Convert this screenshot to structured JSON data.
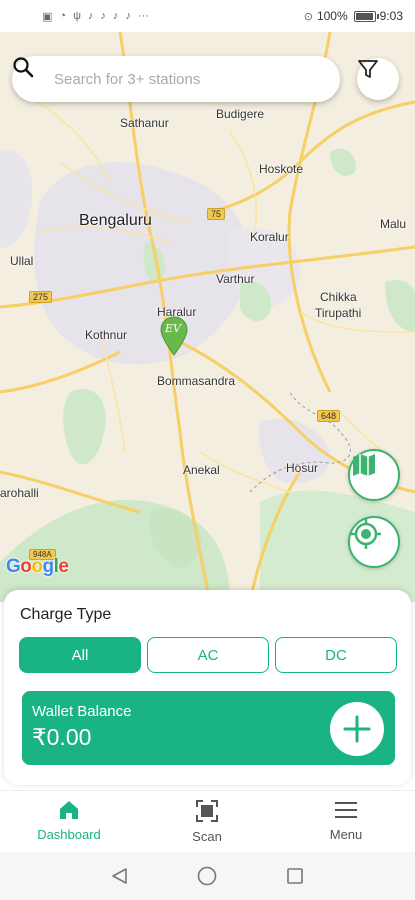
{
  "status_bar": {
    "left_icons": [
      "sim-icon",
      "wifi-icon",
      "usb-icon",
      "usb-icon",
      "usb-icon",
      "usb-icon",
      "usb-icon",
      "more-icon"
    ],
    "battery_text": "100%",
    "battery_level": 1.0,
    "time": "9:03"
  },
  "search": {
    "placeholder": "Search for 3+ stations"
  },
  "map": {
    "labels": {
      "sathanur": "Sathanur",
      "budigere": "Budigere",
      "hoskote": "Hoskote",
      "bengaluru": "Bengaluru",
      "koralur": "Koralur",
      "malur": "Malu",
      "ullal": "Ullal",
      "varthur": "Varthur",
      "chikka_tirupathi_1": "Chikka",
      "chikka_tirupathi_2": "Tirupathi",
      "haralur": "Haralur",
      "kothnur": "Kothnur",
      "bommasandra": "Bommasandra",
      "anekal": "Anekal",
      "hosur": "Hosur",
      "harohalli": "arohalli"
    },
    "shields": {
      "s75": "75",
      "s275": "275",
      "s648": "648",
      "s948a": "948A"
    },
    "pin_label": "EV",
    "google": [
      "G",
      "o",
      "o",
      "g",
      "l",
      "e"
    ]
  },
  "charge_type": {
    "title": "Charge Type",
    "tabs": [
      {
        "label": "All",
        "active": true
      },
      {
        "label": "AC",
        "active": false
      },
      {
        "label": "DC",
        "active": false
      }
    ]
  },
  "wallet": {
    "label": "Wallet Balance",
    "value": "₹0.00"
  },
  "nav": {
    "dashboard": "Dashboard",
    "scan": "Scan",
    "menu": "Menu"
  },
  "colors": {
    "accent": "#1ab384",
    "map_bg": "#f3eedf"
  }
}
